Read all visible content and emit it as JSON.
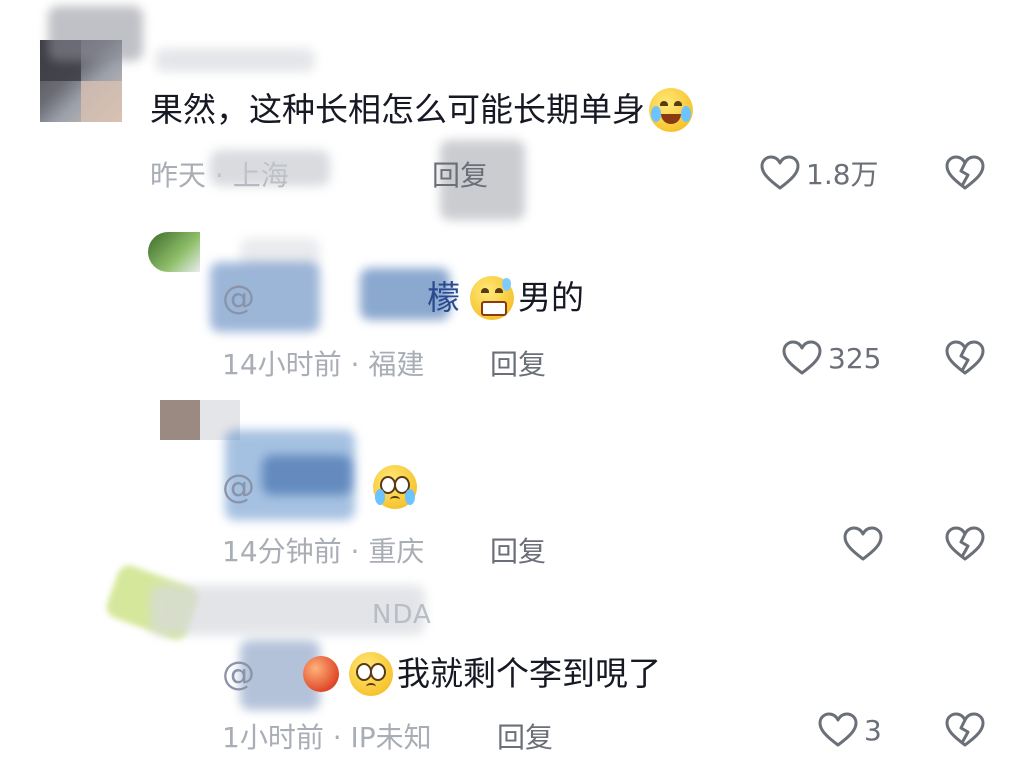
{
  "comments": [
    {
      "text": "果然，这种长相怎么可能长期单身",
      "time_location": "昨天 · 上海",
      "reply_label": "回复",
      "like_count": "1.8万"
    },
    {
      "mention": "@",
      "mention_tail": "檬",
      "text": "男的",
      "time_location": "14小时前 · 福建",
      "reply_label": "回复",
      "like_count": "325"
    },
    {
      "mention": "@",
      "text": "",
      "time_location": "14分钟前 · 重庆",
      "reply_label": "回复",
      "like_count": ""
    },
    {
      "username": "NDA",
      "mention": "@",
      "text": "我就剩个李到哯了",
      "time_location": "1小时前 · IP未知",
      "reply_label": "回复",
      "like_count": "3"
    }
  ],
  "icons": {
    "like": "heart-outline-icon",
    "dislike": "broken-heart-icon"
  },
  "colors": {
    "text_primary": "#161823",
    "text_meta": "#a9adb5",
    "action_gray": "#6b6f78",
    "mention_blue": "#2a4a8f"
  }
}
